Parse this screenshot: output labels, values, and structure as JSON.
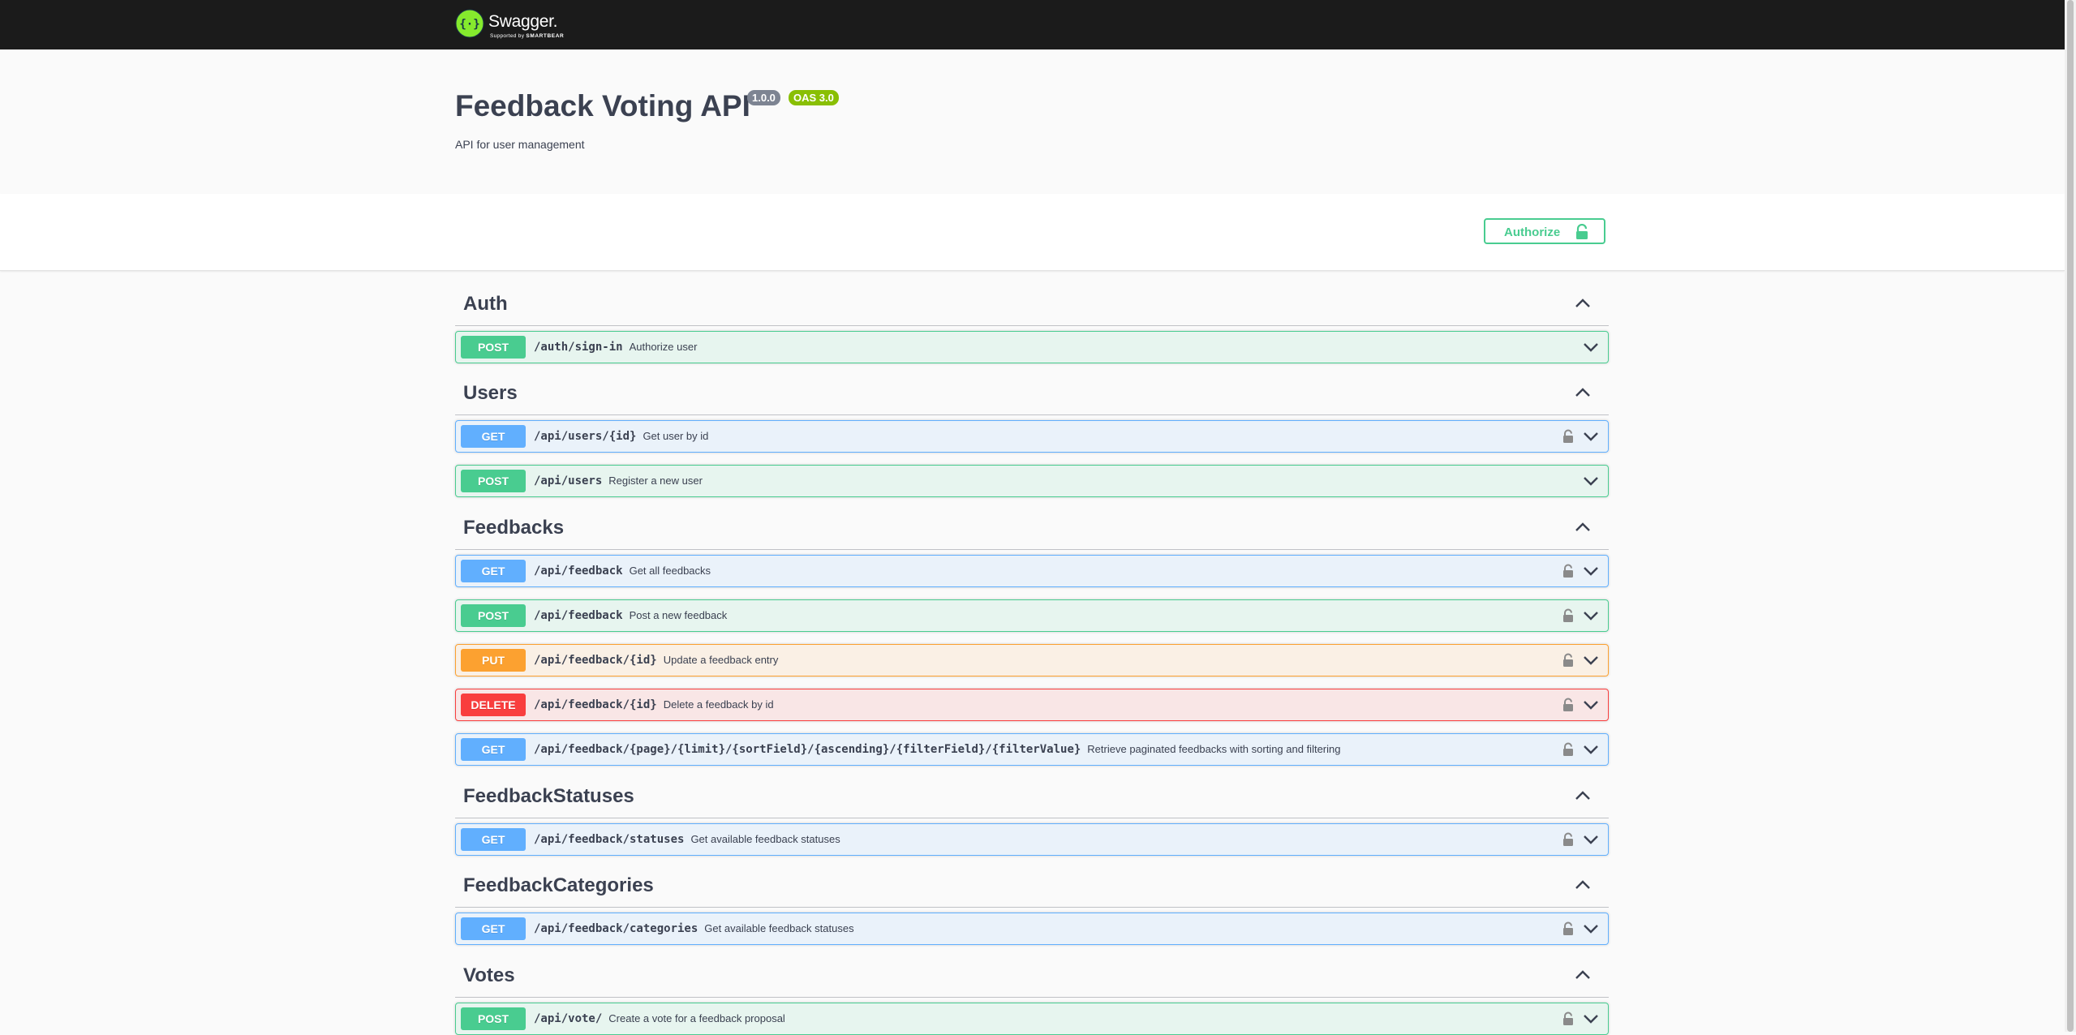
{
  "topbar": {
    "brand": "Swagger.",
    "supported_by": "Supported by",
    "smartbear": "SMARTBEAR"
  },
  "info": {
    "title": "Feedback Voting API",
    "version": "1.0.0",
    "oas": "OAS 3.0",
    "description": "API for user management"
  },
  "authorize": {
    "label": "Authorize"
  },
  "colors": {
    "post": "#49cc90",
    "get": "#61affe",
    "put": "#fca130",
    "delete": "#f93e3e",
    "topbar": "#1b1b1b"
  },
  "tags": [
    {
      "name": "Auth",
      "operations": [
        {
          "method": "POST",
          "path": "/auth/sign-in",
          "summary": "Authorize user",
          "locked": false
        }
      ]
    },
    {
      "name": "Users",
      "operations": [
        {
          "method": "GET",
          "path": "/api/users/{id}",
          "summary": "Get user by id",
          "locked": true
        },
        {
          "method": "POST",
          "path": "/api/users",
          "summary": "Register a new user",
          "locked": false
        }
      ]
    },
    {
      "name": "Feedbacks",
      "operations": [
        {
          "method": "GET",
          "path": "/api/feedback",
          "summary": "Get all feedbacks",
          "locked": true
        },
        {
          "method": "POST",
          "path": "/api/feedback",
          "summary": "Post a new feedback",
          "locked": true
        },
        {
          "method": "PUT",
          "path": "/api/feedback/{id}",
          "summary": "Update a feedback entry",
          "locked": true
        },
        {
          "method": "DELETE",
          "path": "/api/feedback/{id}",
          "summary": "Delete a feedback by id",
          "locked": true
        },
        {
          "method": "GET",
          "path": "/api/feedback/{page}/{limit}/{sortField}/{ascending}/{filterField}/{filterValue}",
          "summary": "Retrieve paginated feedbacks with sorting and filtering",
          "locked": true
        }
      ]
    },
    {
      "name": "FeedbackStatuses",
      "operations": [
        {
          "method": "GET",
          "path": "/api/feedback/statuses",
          "summary": "Get available feedback statuses",
          "locked": true
        }
      ]
    },
    {
      "name": "FeedbackCategories",
      "operations": [
        {
          "method": "GET",
          "path": "/api/feedback/categories",
          "summary": "Get available feedback statuses",
          "locked": true
        }
      ]
    },
    {
      "name": "Votes",
      "operations": [
        {
          "method": "POST",
          "path": "/api/vote/",
          "summary": "Create a vote for a feedback proposal",
          "locked": true
        }
      ]
    }
  ]
}
